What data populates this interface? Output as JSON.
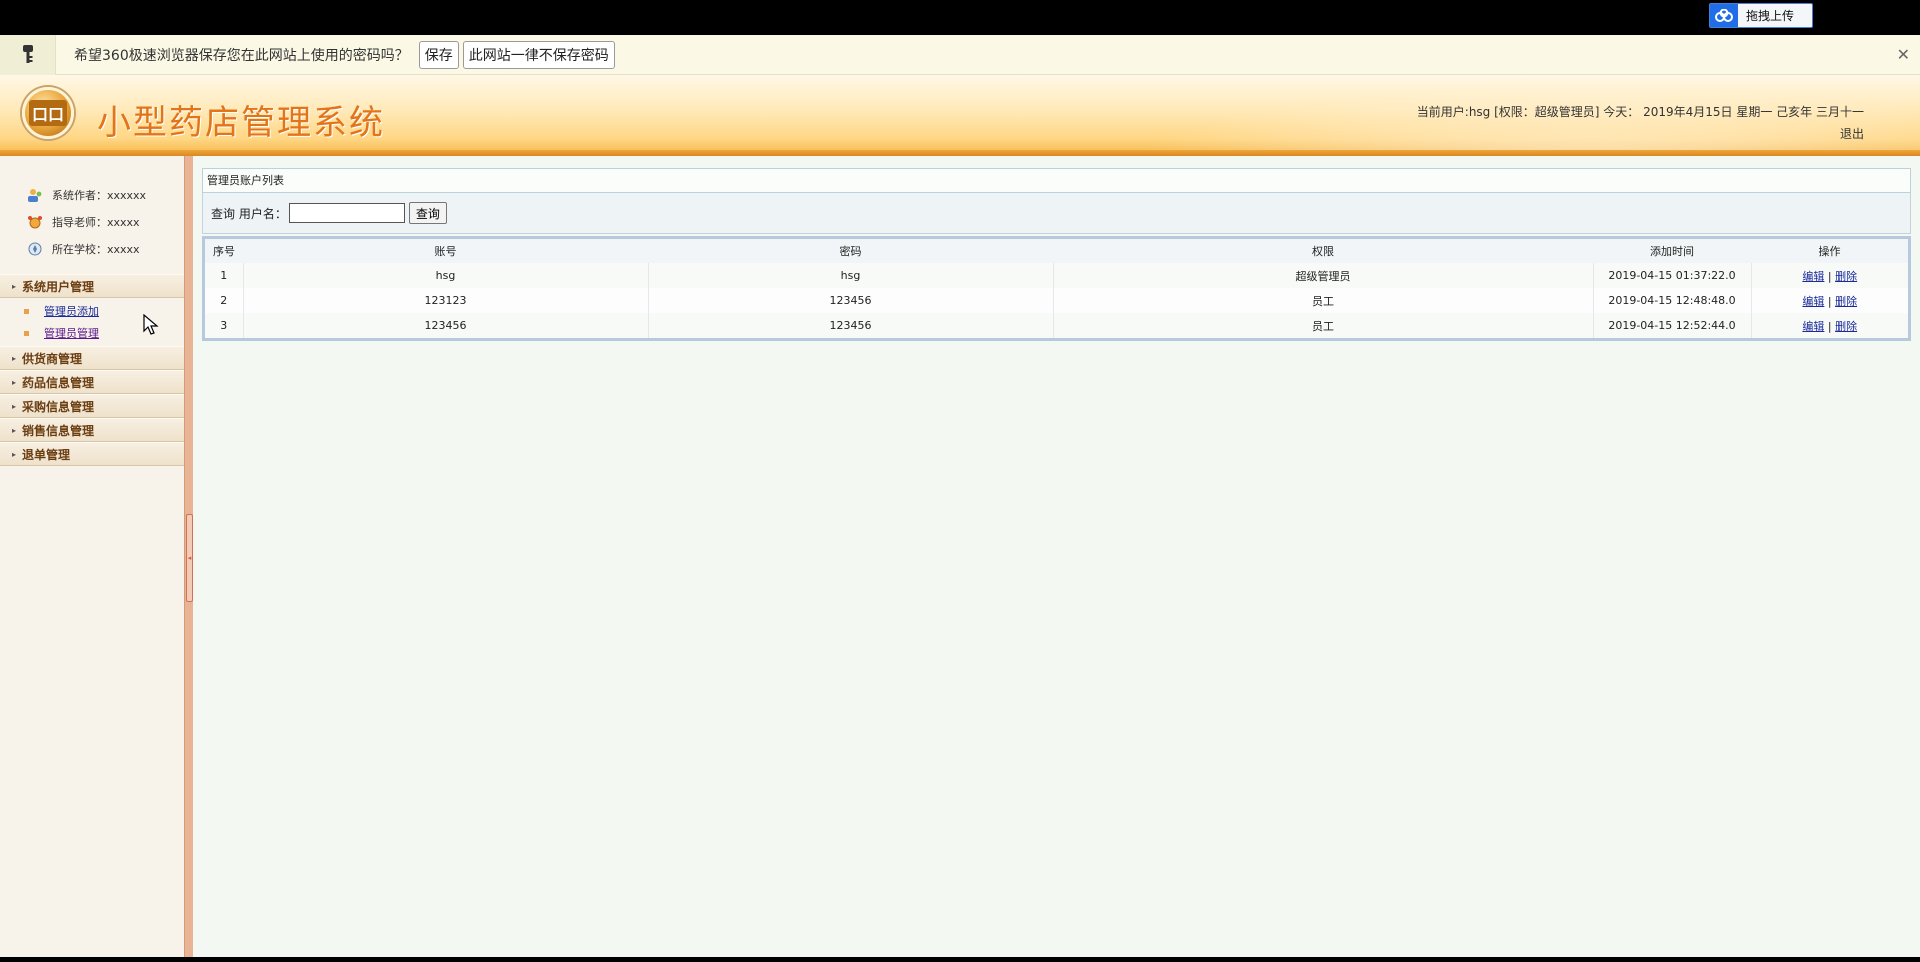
{
  "browser": {
    "upload_label": "拖拽上传",
    "save_prompt": "希望360极速浏览器保存您在此网站上使用的密码吗？",
    "save_button": "保存",
    "never_button": "此网站一律不保存密码",
    "close_glyph": "✕"
  },
  "header": {
    "logo_text": "口口",
    "title": "小型药店管理系统",
    "userinfo": "当前用户:hsg [权限：超级管理员] 今天： 2019年4月15日 星期一 己亥年 三月十一",
    "logout": "退出"
  },
  "sidebar": {
    "info": [
      {
        "label": "系统作者：xxxxxx"
      },
      {
        "label": "指导老师：xxxxx"
      },
      {
        "label": "所在学校：xxxxx"
      }
    ],
    "menus": [
      {
        "label": "系统用户管理",
        "children": [
          {
            "label": "管理员添加"
          },
          {
            "label": "管理员管理"
          }
        ]
      },
      {
        "label": "供货商管理"
      },
      {
        "label": "药品信息管理"
      },
      {
        "label": "采购信息管理"
      },
      {
        "label": "销售信息管理"
      },
      {
        "label": "退单管理"
      }
    ],
    "arrow": "▸"
  },
  "splitter": {
    "handle_glyph": "◂"
  },
  "panel": {
    "title": "管理员账户列表",
    "search_label": "查询 用户名：",
    "search_value": "",
    "search_button": "查询",
    "columns": [
      "序号",
      "账号",
      "密码",
      "权限",
      "添加时间",
      "操作"
    ],
    "rows": [
      {
        "no": "1",
        "account": "hsg",
        "password": "hsg",
        "role": "超级管理员",
        "time": "2019-04-15 01:37:22.0"
      },
      {
        "no": "2",
        "account": "123123",
        "password": "123456",
        "role": "员工",
        "time": "2019-04-15 12:48:48.0"
      },
      {
        "no": "3",
        "account": "123456",
        "password": "123456",
        "role": "员工",
        "time": "2019-04-15 12:52:44.0"
      }
    ],
    "edit_label": "编辑",
    "separator": "|",
    "delete_label": "删除"
  }
}
